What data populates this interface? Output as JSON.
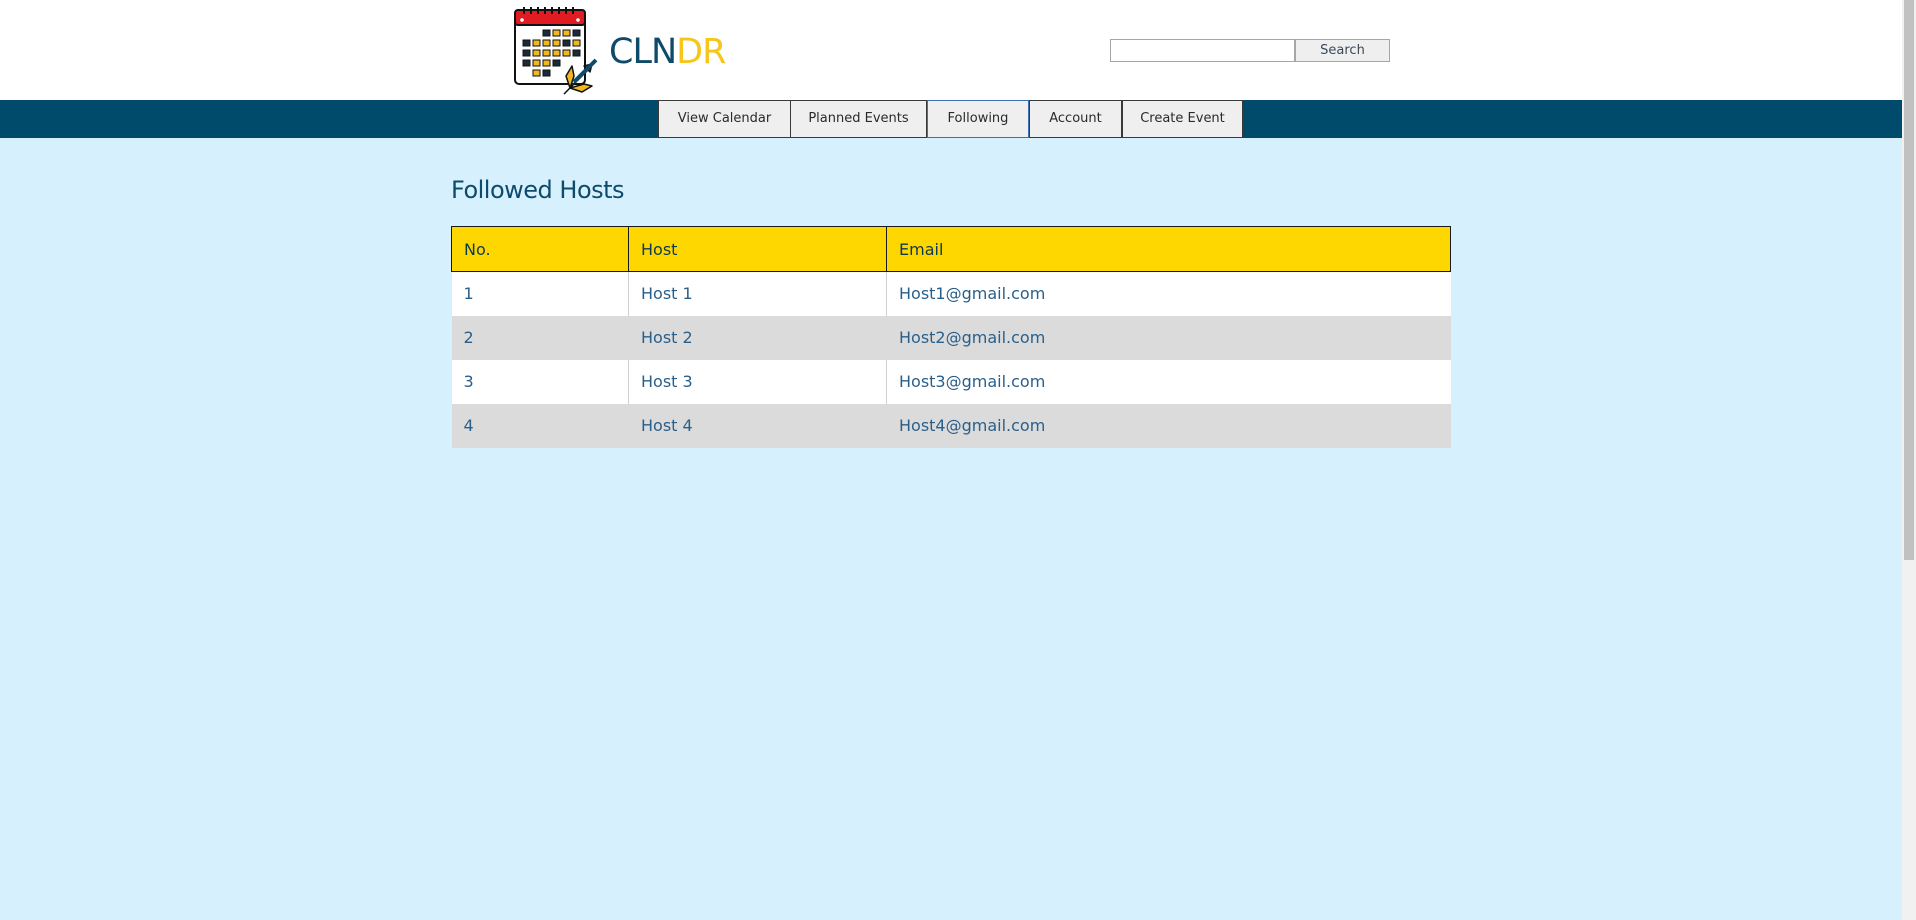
{
  "logo": {
    "text_part1": "CLN",
    "text_part2": "DR",
    "color_part1": "#0e4b6b",
    "color_part2": "#f6c61c",
    "icon": "calendar-trident-icon"
  },
  "search": {
    "value": "",
    "placeholder": "",
    "button_label": "Search"
  },
  "nav": {
    "items": [
      {
        "label": "View Calendar"
      },
      {
        "label": "Planned Events"
      },
      {
        "label": "Following",
        "active": true
      },
      {
        "label": "Account"
      },
      {
        "label": "Create Event"
      }
    ]
  },
  "main": {
    "title": "Followed Hosts",
    "table": {
      "headers": [
        "No.",
        "Host",
        "Email"
      ],
      "rows": [
        [
          "1",
          "Host 1",
          "Host1@gmail.com"
        ],
        [
          "2",
          "Host 2",
          "Host2@gmail.com"
        ],
        [
          "3",
          "Host 3",
          "Host3@gmail.com"
        ],
        [
          "4",
          "Host 4",
          "Host4@gmail.com"
        ]
      ]
    }
  },
  "colors": {
    "page_background": "#d6f1fd",
    "navbar": "#004a6c",
    "table_header": "#ffd700",
    "row_alt": "#dbdbdb"
  }
}
